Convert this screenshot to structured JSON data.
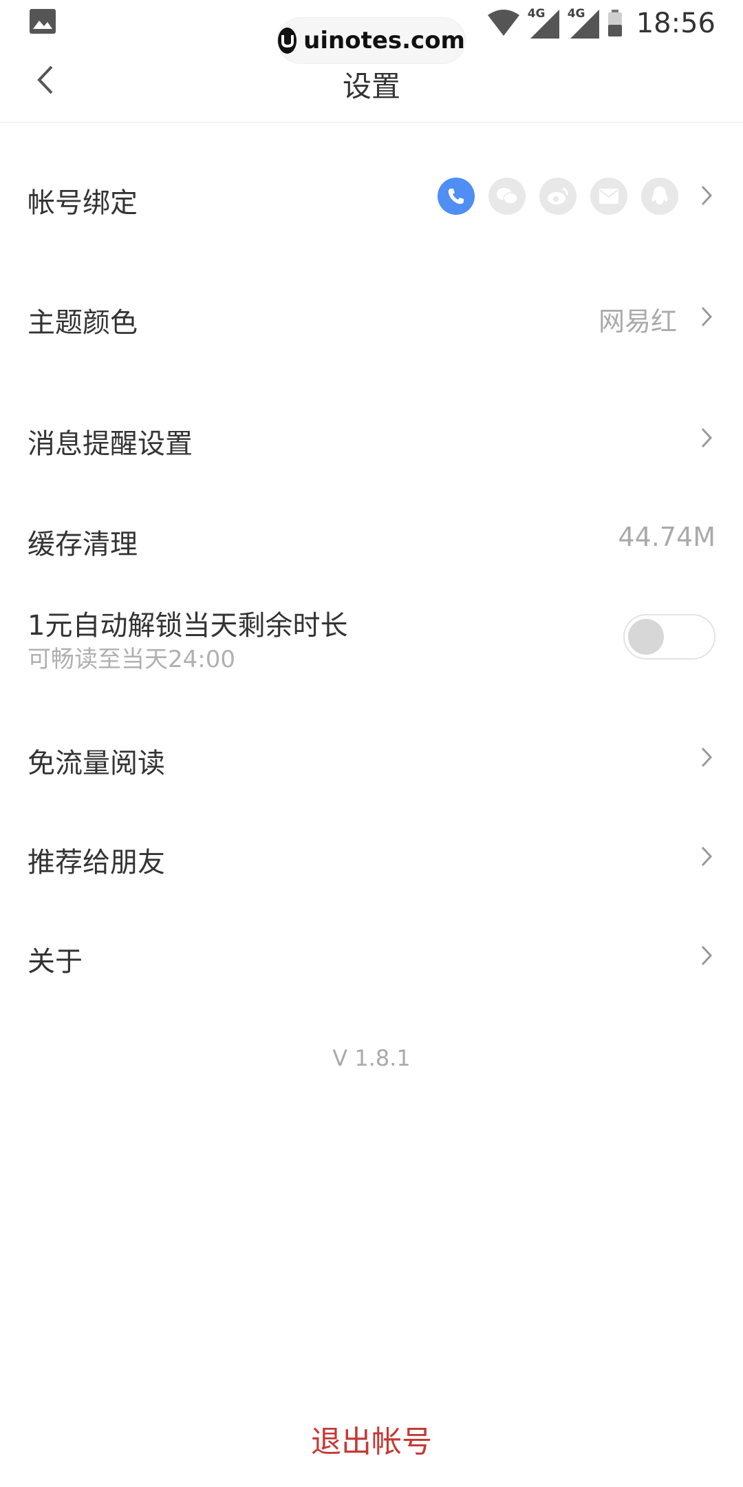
{
  "status_bar": {
    "time": "18:56",
    "net1": "4G",
    "net2": "4G",
    "icons": [
      "gallery-icon",
      "wifi-icon",
      "signal-icon",
      "battery-icon"
    ]
  },
  "watermark": {
    "text": "uinotes.com"
  },
  "nav": {
    "title": "设置",
    "back_icon": "chevron-left-icon"
  },
  "settings": {
    "account_binding": {
      "label": "帐号绑定",
      "icons": [
        "phone-icon",
        "wechat-icon",
        "weibo-icon",
        "mail-icon",
        "qq-icon"
      ]
    },
    "theme_color": {
      "label": "主题颜色",
      "value": "网易红"
    },
    "notification": {
      "label": "消息提醒设置"
    },
    "cache": {
      "label": "缓存清理",
      "value": "44.74M"
    },
    "unlock": {
      "label": "1元自动解锁当天剩余时长",
      "sub": "可畅读至当天24:00",
      "enabled": false
    },
    "free_data": {
      "label": "免流量阅读"
    },
    "recommend": {
      "label": "推荐给朋友"
    },
    "about": {
      "label": "关于"
    }
  },
  "version": "V 1.8.1",
  "logout": {
    "label": "退出帐号"
  },
  "colors": {
    "accent": "#c43a35",
    "phone_active": "#4f8ef3"
  }
}
